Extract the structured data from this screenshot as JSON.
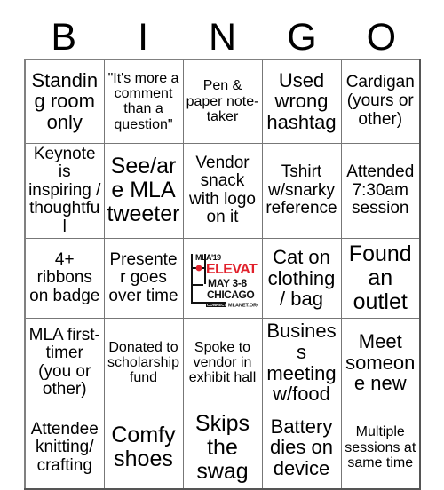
{
  "header": {
    "letters": [
      "B",
      "I",
      "N",
      "G",
      "O"
    ]
  },
  "grid": {
    "rows": [
      [
        {
          "text": "Standing room only",
          "size": "lg"
        },
        {
          "text": "\"It's more a comment than a question\"",
          "size": "sm"
        },
        {
          "text": "Pen & paper note-taker",
          "size": "sm"
        },
        {
          "text": "Used wrong hashtag",
          "size": "lg"
        },
        {
          "text": "Cardigan (yours or other)",
          "size": "md"
        }
      ],
      [
        {
          "text": "Keynote is inspiring / thoughtful",
          "size": "md"
        },
        {
          "text": "See/are MLA tweeter",
          "size": "xl"
        },
        {
          "text": "Vendor snack with logo on it",
          "size": "md"
        },
        {
          "text": "Tshirt w/snarky reference",
          "size": "md"
        },
        {
          "text": "Attended 7:30am session",
          "size": "md"
        }
      ],
      [
        {
          "text": "4+ ribbons on badge",
          "size": "md"
        },
        {
          "text": "Presenter goes over time",
          "size": "md"
        },
        {
          "type": "logo"
        },
        {
          "text": "Cat on clothing / bag",
          "size": "lg"
        },
        {
          "text": "Found an outlet",
          "size": "xl"
        }
      ],
      [
        {
          "text": "MLA first-timer (you or other)",
          "size": "md"
        },
        {
          "text": "Donated to scholarship fund",
          "size": "sm"
        },
        {
          "text": "Spoke to vendor in exhibit hall",
          "size": "sm"
        },
        {
          "text": "Business meeting w/food",
          "size": "lg"
        },
        {
          "text": "Meet someone new",
          "size": "lg"
        }
      ],
      [
        {
          "text": "Attendee knitting/ crafting",
          "size": "md"
        },
        {
          "text": "Comfy shoes",
          "size": "xl"
        },
        {
          "text": "Skips the swag",
          "size": "xl"
        },
        {
          "text": "Battery dies on device",
          "size": "lg"
        },
        {
          "text": "Multiple sessions at same time",
          "size": "sm"
        }
      ]
    ]
  },
  "logo": {
    "brand": "MLA'19",
    "headline": "ELEVATE",
    "dates": "MAY 3-8",
    "city": "CHICAGO",
    "badge": "CONNECT",
    "url": "MLANET.ORG",
    "accent_color": "#e1202b",
    "text_color": "#111111"
  }
}
